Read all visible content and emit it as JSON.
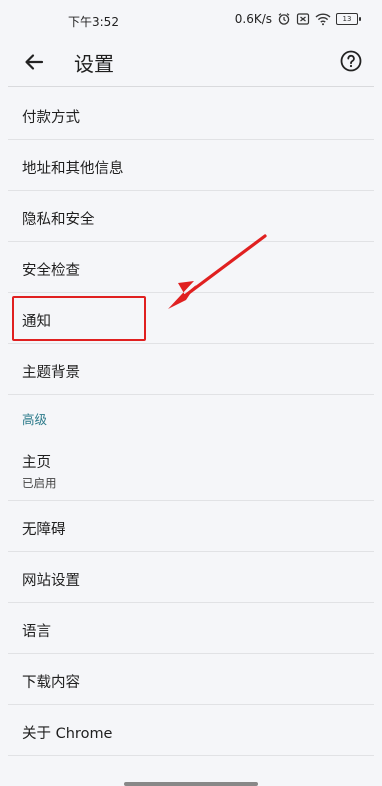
{
  "status_bar": {
    "time": "下午3:52",
    "net_speed": "0.6K/s",
    "battery_level": "13",
    "icons": [
      "alarm-icon",
      "sim-card-icon",
      "wifi-icon",
      "battery-icon"
    ]
  },
  "app_bar": {
    "title": "设置",
    "back_icon": "back-arrow-icon",
    "help_icon": "help-icon"
  },
  "settings_items": [
    {
      "label": "付款方式"
    },
    {
      "label": "地址和其他信息"
    },
    {
      "label": "隐私和安全"
    },
    {
      "label": "安全检查"
    },
    {
      "label": "通知"
    },
    {
      "label": "主题背景"
    }
  ],
  "advanced_section": {
    "header": "高级",
    "items": [
      {
        "label": "主页",
        "sublabel": "已启用"
      },
      {
        "label": "无障碍"
      },
      {
        "label": "网站设置"
      },
      {
        "label": "语言"
      },
      {
        "label": "下载内容"
      },
      {
        "label": "关于 Chrome"
      }
    ]
  },
  "annotation": {
    "highlighted_item": "通知",
    "color": "#e02020"
  }
}
